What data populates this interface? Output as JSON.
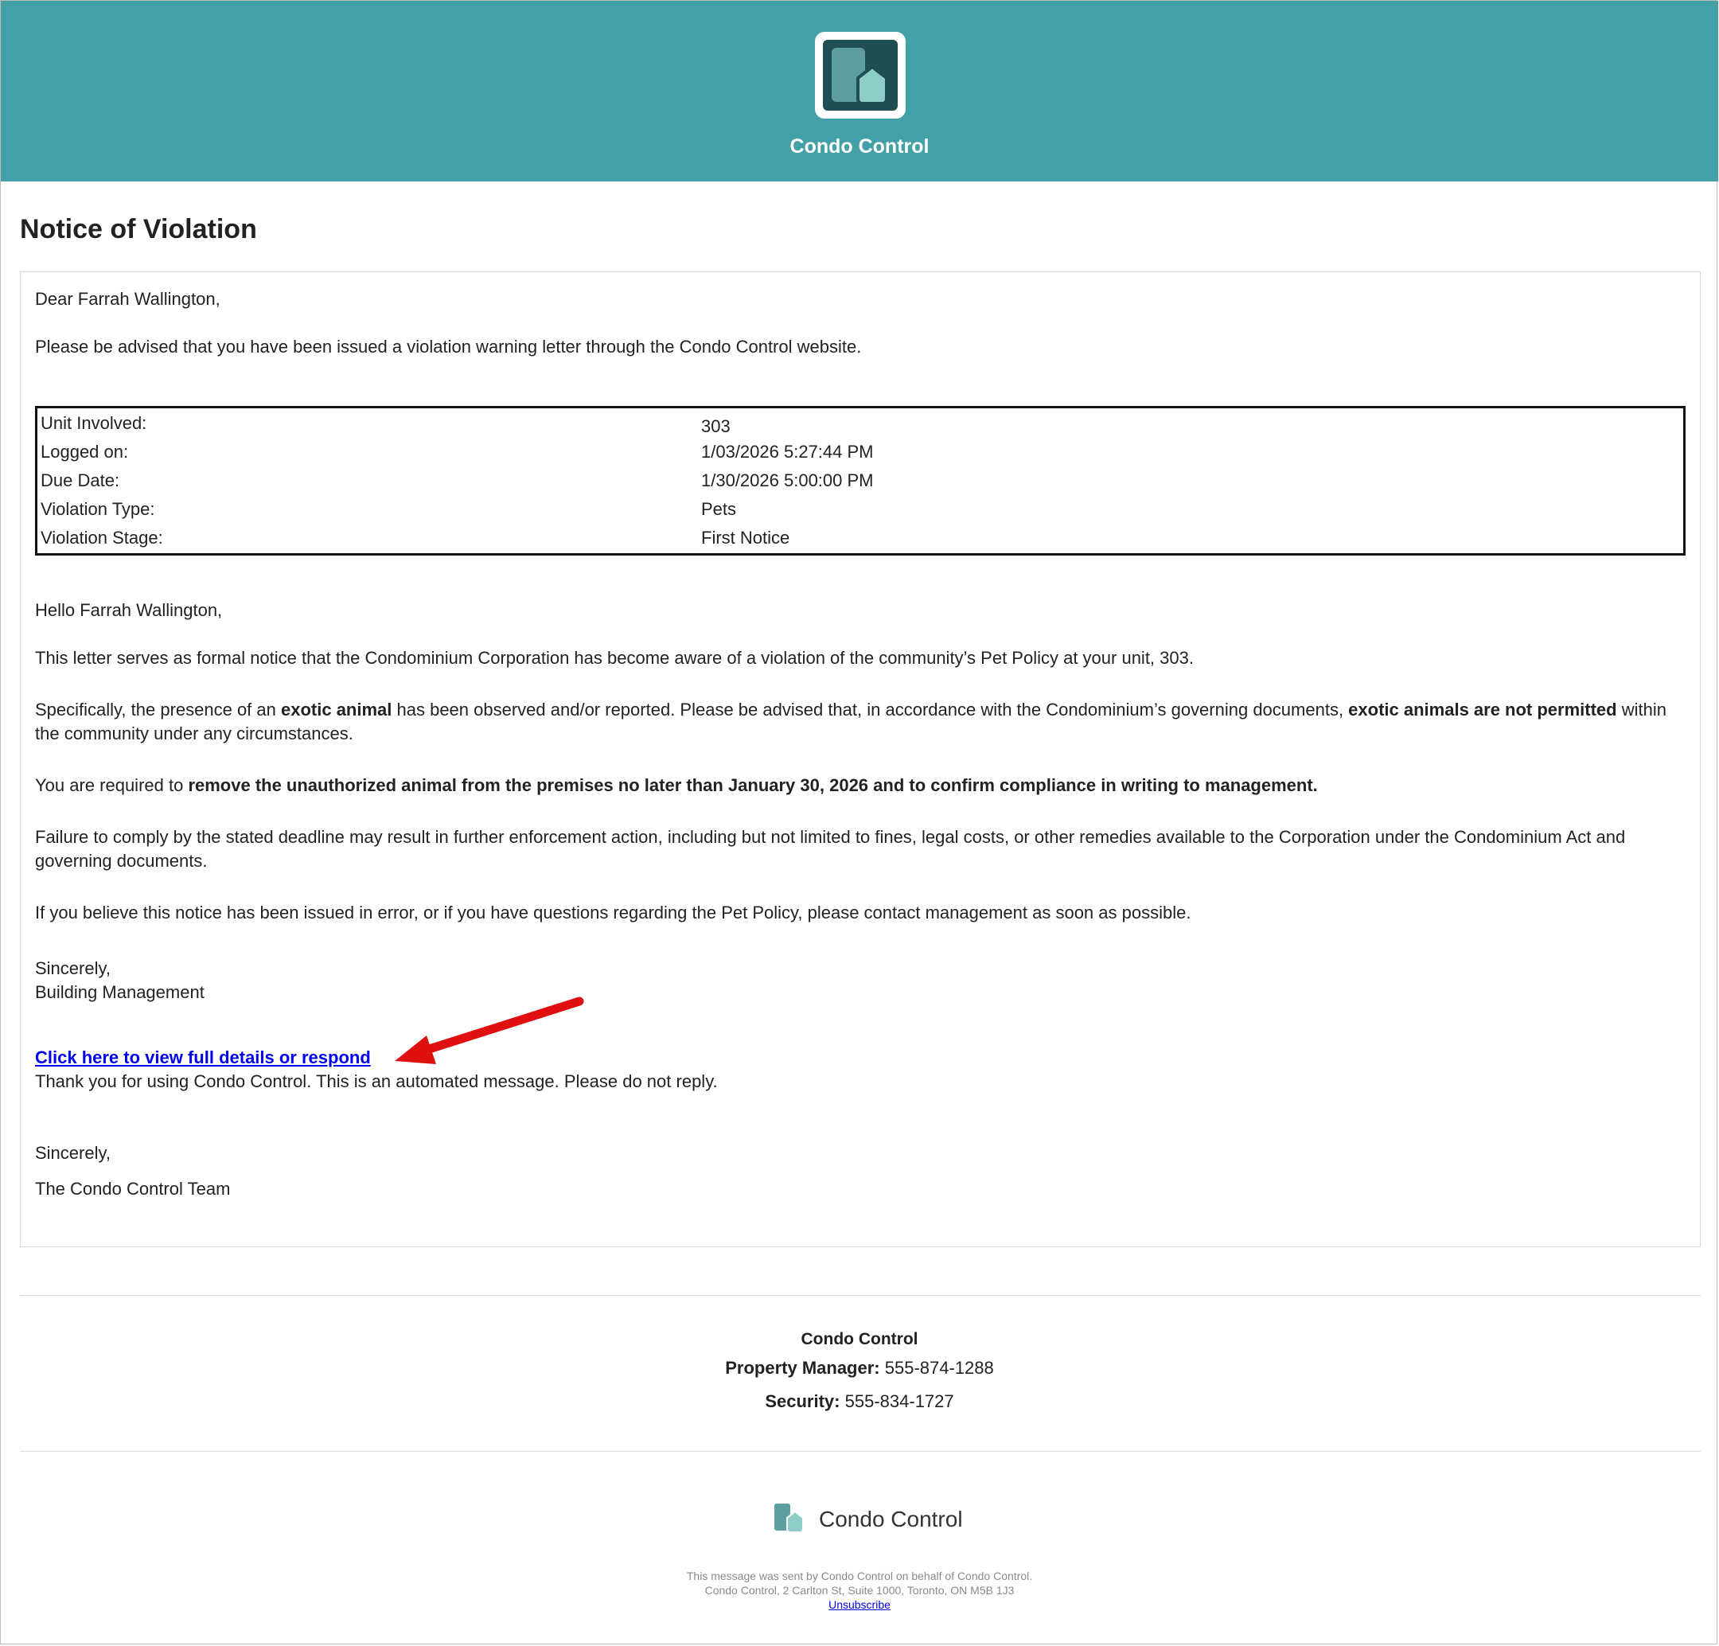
{
  "header": {
    "brand": "Condo Control",
    "logo_icon": "condo-control-logo-icon"
  },
  "notice": {
    "title": "Notice of Violation",
    "greeting": "Dear Farrah Wallington,",
    "intro": "Please be advised that you have been issued a violation warning letter through the Condo Control website.",
    "details": [
      {
        "label": "Unit Involved:",
        "value": "303"
      },
      {
        "label": "Logged on:",
        "value": "1/03/2026  5:27:44 PM"
      },
      {
        "label": "Due Date:",
        "value": "1/30/2026  5:00:00 PM"
      },
      {
        "label": "Violation Type:",
        "value": "Pets"
      },
      {
        "label": "Violation Stage:",
        "value": "First Notice"
      }
    ],
    "hello": "Hello Farrah Wallington,",
    "para1": "This letter serves as formal notice that the Condominium Corporation has become aware of a violation of the community’s Pet Policy at your unit, 303.",
    "para2_a": "Specifically, the presence of an ",
    "para2_b": "exotic animal",
    "para2_c": " has been observed and/or reported. Please be advised that, in accordance with the Condominium’s governing documents, ",
    "para2_d": "exotic animals are not permitted",
    "para2_e": " within the community under any circumstances.",
    "para3_a": "You are required to ",
    "para3_b": "remove the unauthorized animal from the premises no later than January 30, 2026 and to confirm compliance in writing to management.",
    "para4": "Failure to comply by the stated deadline may result in further enforcement action, including but not limited to fines, legal costs, or other remedies available to the Corporation under the Condominium Act and governing documents.",
    "para5": "If you believe this notice has been issued in error, or if you have questions regarding the Pet Policy, please contact management as soon as possible.",
    "sign1": "Sincerely,",
    "sign2": "Building Management",
    "link": "Click here to view full details or respond",
    "automated": "Thank you for using Condo Control. This is an automated message. Please do not reply.",
    "closing1": "Sincerely,",
    "closing2": "The Condo Control Team"
  },
  "footer": {
    "company": "Condo Control",
    "pm_label": "Property Manager:",
    "pm_phone": "555-874-1288",
    "sec_label": "Security:",
    "sec_phone": "555-834-1727",
    "logo_text": "Condo Control",
    "sent_by": "This message was sent by Condo Control on behalf of Condo Control.",
    "address": "Condo Control, 2 Carlton St, Suite 1000, Toronto, ON M5B 1J3",
    "unsubscribe": "Unsubscribe"
  },
  "colors": {
    "header_bg": "#42a0a6",
    "logo_dark": "#1f4f52",
    "logo_mid": "#5e9ea0",
    "logo_light": "#8fcdc8",
    "link": "#0000ee",
    "arrow": "#e01010"
  }
}
